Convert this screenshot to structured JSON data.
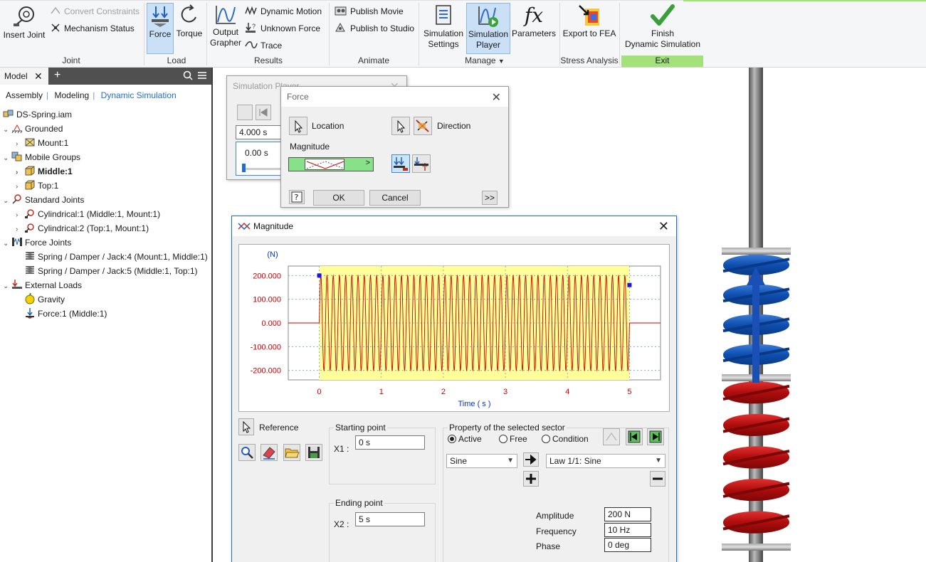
{
  "ribbon": {
    "joint": {
      "insert_joint": "Insert Joint",
      "convert_constraints": "Convert Constraints",
      "mechanism_status": "Mechanism Status",
      "panel": "Joint"
    },
    "load": {
      "force": "Force",
      "torque": "Torque",
      "panel": "Load"
    },
    "results": {
      "output_grapher_1": "Output",
      "output_grapher_2": "Grapher",
      "dynamic_motion": "Dynamic Motion",
      "unknown_force": "Unknown Force",
      "trace": "Trace",
      "panel": "Results"
    },
    "animate": {
      "publish_movie": "Publish Movie",
      "publish_studio": "Publish to Studio",
      "panel": "Animate"
    },
    "manage": {
      "sim_settings_1": "Simulation",
      "sim_settings_2": "Settings",
      "sim_player_1": "Simulation",
      "sim_player_2": "Player",
      "parameters": "Parameters",
      "panel": "Manage"
    },
    "stress": {
      "export_fea": "Export to FEA",
      "panel": "Stress Analysis"
    },
    "exit": {
      "finish_1": "Finish",
      "finish_2": "Dynamic Simulation",
      "panel": "Exit"
    }
  },
  "browser": {
    "tab_model": "Model",
    "subtabs": [
      "Assembly",
      "Modeling",
      "Dynamic Simulation"
    ],
    "tree": [
      {
        "label": "DS-Spring.iam",
        "icon": "assembly-icon"
      },
      {
        "label": "Grounded",
        "icon": "grounded-icon"
      },
      {
        "label": "Mount:1",
        "icon": "part-icon"
      },
      {
        "label": "Mobile Groups",
        "icon": "mobile-groups-icon"
      },
      {
        "label": "Middle:1",
        "icon": "part-yellow-icon"
      },
      {
        "label": "Top:1",
        "icon": "part-yellow-icon"
      },
      {
        "label": "Standard Joints",
        "icon": "joints-icon"
      },
      {
        "label": "Cylindrical:1 (Middle:1, Mount:1)",
        "icon": "joint-icon"
      },
      {
        "label": "Cylindrical:2 (Top:1, Mount:1)",
        "icon": "joint-icon"
      },
      {
        "label": "Force Joints",
        "icon": "force-joints-icon"
      },
      {
        "label": "Spring / Damper / Jack:4 (Mount:1, Middle:1)",
        "icon": "spring-icon"
      },
      {
        "label": "Spring / Damper / Jack:5 (Middle:1, Top:1)",
        "icon": "spring-icon"
      },
      {
        "label": "External Loads",
        "icon": "external-loads-icon"
      },
      {
        "label": "Gravity",
        "icon": "gravity-icon"
      },
      {
        "label": "Force:1 (Middle:1)",
        "icon": "force-icon"
      }
    ]
  },
  "sim_player": {
    "title": "Simulation Player",
    "time_end": "4.000 s",
    "time_current": "0.00 s"
  },
  "force_dialog": {
    "title": "Force",
    "location": "Location",
    "direction": "Direction",
    "magnitude": "Magnitude",
    "ok": "OK",
    "cancel": "Cancel",
    "more": ">>"
  },
  "magnitude_dialog": {
    "title": "Magnitude",
    "reference": "Reference",
    "starting_point": "Starting point",
    "x1_label": "X1 :",
    "x1_value": "0 s",
    "ending_point": "Ending point",
    "x2_label": "X2 :",
    "x2_value": "5 s",
    "property_title": "Property of the selected sector",
    "radio_active": "Active",
    "radio_free": "Free",
    "radio_condition": "Condition",
    "law_type": "Sine",
    "law_name": "Law 1/1: Sine",
    "amplitude_label": "Amplitude",
    "amplitude_value": "200 N",
    "frequency_label": "Frequency",
    "frequency_value": "10 Hz",
    "phase_label": "Phase",
    "phase_value": "0 deg"
  },
  "chart_data": {
    "type": "line",
    "ylabel": "(N)",
    "xlabel": "Time ( s )",
    "ylim": [
      -240,
      240
    ],
    "xlim": [
      -0.5,
      5.5
    ],
    "yticks": [
      "200.000",
      "100.000",
      "0.000",
      "-100.000",
      "-200.000"
    ],
    "ytick_values": [
      200,
      100,
      0,
      -100,
      -200
    ],
    "xticks": [
      "0",
      "1",
      "2",
      "3",
      "4",
      "5"
    ],
    "xtick_values": [
      0,
      1,
      2,
      3,
      4,
      5
    ],
    "series": [
      {
        "function": "sine",
        "amplitude": 200,
        "frequency_hz": 10,
        "phase_deg": 0,
        "x_start": 0,
        "x_end": 5
      }
    ],
    "sector": {
      "x_start": 0,
      "x_end": 5
    },
    "colors": {
      "curve": "#cc0000",
      "sector_fill": "#ffff99",
      "grid": "#6a9fd6",
      "tick_label_y": "#cc0000",
      "tick_label_x": "#cc0000",
      "axis_label": "#0033cc"
    }
  }
}
